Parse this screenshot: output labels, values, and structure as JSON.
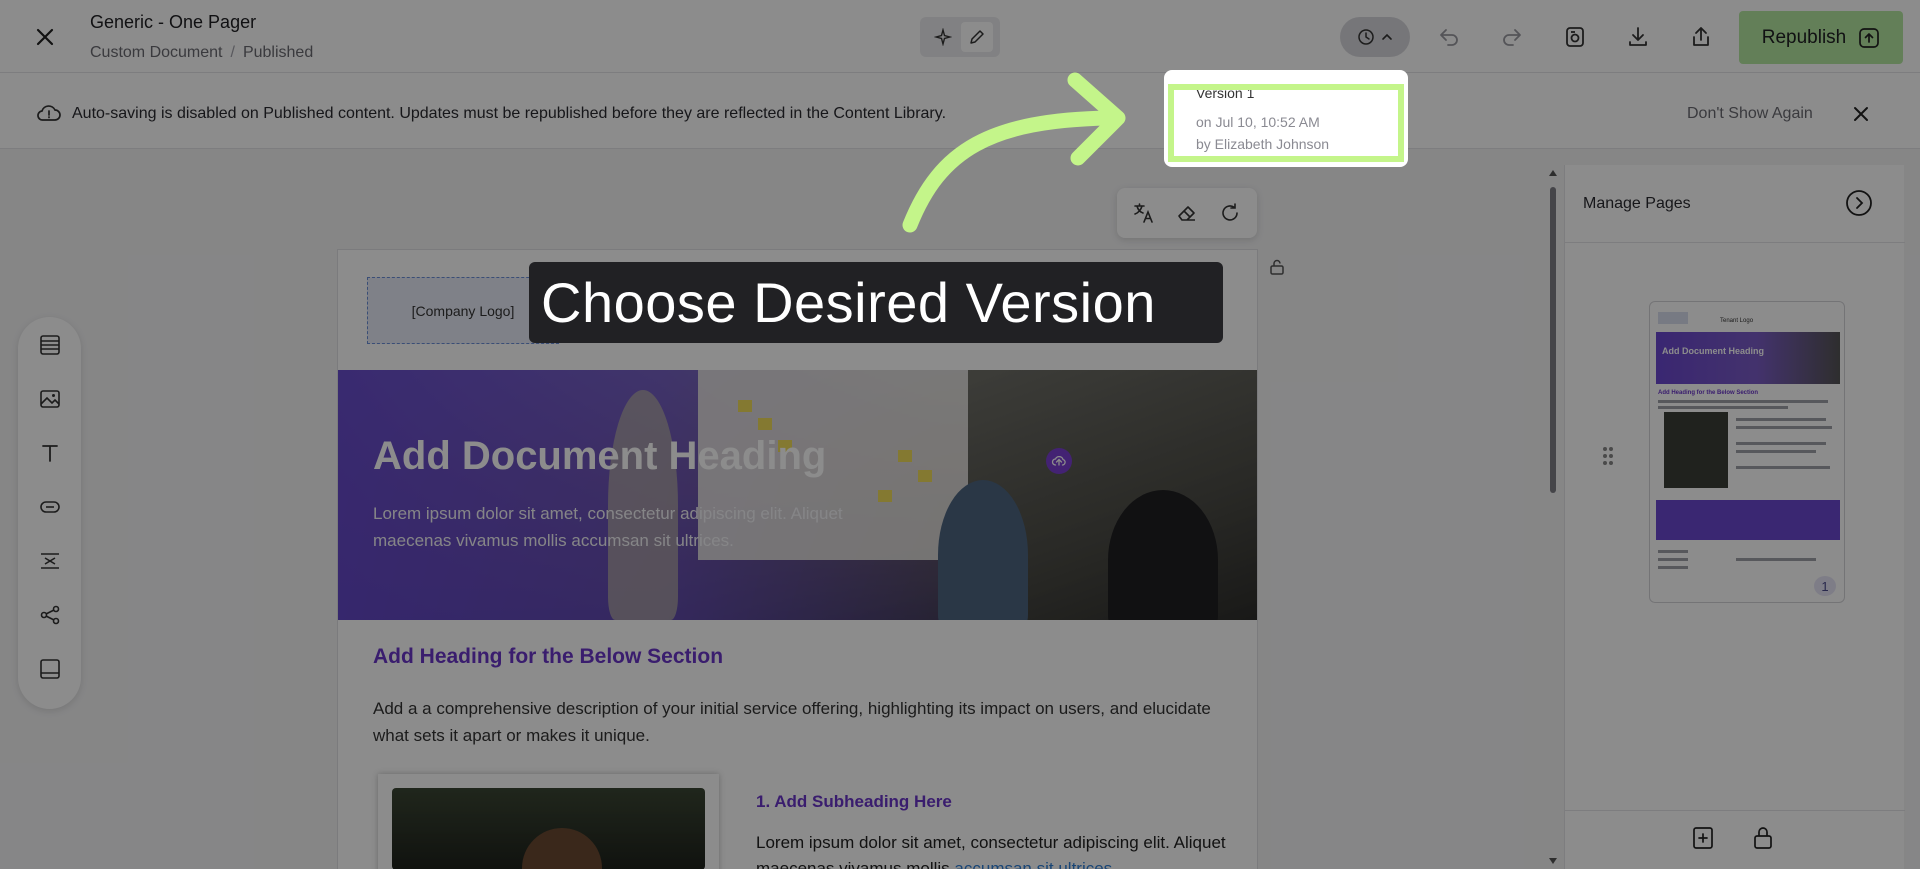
{
  "header": {
    "title": "Generic - One Pager",
    "breadcrumb": [
      "Custom Document",
      "Published"
    ],
    "republish_label": "Republish"
  },
  "notice": {
    "text": "Auto-saving is disabled on Published content. Updates must be republished before they are reflected in the Content Library.",
    "dismiss_label": "Don't Show Again"
  },
  "version_popup": {
    "name": "Version 1",
    "date": "on Jul 10, 10:52 AM",
    "author": "by Elizabeth Johnson"
  },
  "callout": {
    "text": "Choose Desired Version"
  },
  "document": {
    "logo_placeholder": "[Company Logo]",
    "hero_title": "Add Document Heading",
    "hero_subtitle": "Lorem ipsum dolor sit amet, consectetur adipiscing elit. Aliquet maecenas vivamus mollis accumsan sit ultrices.",
    "section_heading": "Add Heading for the Below Section",
    "section_text": "Add a a comprehensive description of your initial service offering, highlighting its impact on users, and elucidate what sets it apart or makes it unique.",
    "subheading": "1. Add Subheading Here",
    "sub_text_start": "Lorem ipsum dolor sit amet, consectetur adipiscing elit. Aliquet maecenas vivamus mollis ",
    "sub_text_link": "accumsan sit ultrices"
  },
  "right_panel": {
    "title": "Manage Pages",
    "thumbnail": {
      "tenant_logo": "Tenant Logo",
      "hero_title": "Add Document Heading",
      "heading": "Add Heading for the Below Section",
      "page_number": "1"
    }
  },
  "colors": {
    "accent_green": "#c4f58a",
    "republish_bg": "#b5e8a0",
    "brand_purple": "#6a36c9",
    "link_blue": "#2f7fd6"
  },
  "icons": {
    "close": "close-icon",
    "sparkle": "sparkle-icon",
    "pencil": "pencil-icon",
    "history": "clock-icon",
    "undo": "undo-icon",
    "redo": "redo-icon",
    "preview": "preview-icon",
    "download": "download-icon",
    "share": "share-icon",
    "cloud_alert": "cloud-icon",
    "translate": "translate-icon",
    "eraser": "eraser-icon",
    "refresh": "refresh-icon",
    "lock": "lock-icon"
  }
}
